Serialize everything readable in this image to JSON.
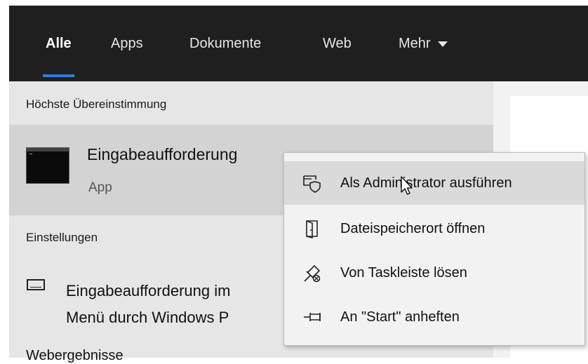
{
  "tabs": [
    {
      "label": "Alle"
    },
    {
      "label": "Apps"
    },
    {
      "label": "Dokumente"
    },
    {
      "label": "Web"
    },
    {
      "label": "Mehr"
    }
  ],
  "best_match": {
    "section_title": "Höchste Übereinstimmung",
    "title": "Eingabeaufforderung",
    "subtitle": "App",
    "icon": "command-prompt-icon"
  },
  "settings": {
    "section_title": "Einstellungen",
    "item_line1": "Eingabeaufforderung im",
    "item_line2": "Menü durch Windows P",
    "icon": "display-icon"
  },
  "web_section_peek": "Webergebnisse",
  "context_menu": {
    "items": [
      {
        "label": "Als Administrator ausführen",
        "icon": "run-as-admin-shield-icon"
      },
      {
        "label": "Dateispeicherort öffnen",
        "icon": "open-file-location-icon"
      },
      {
        "label": "Von Taskleiste lösen",
        "icon": "unpin-taskbar-icon"
      },
      {
        "label": "An \"Start\" anheften",
        "icon": "pin-start-icon"
      }
    ]
  },
  "colors": {
    "topbar_bg": "#1f1f1f",
    "accent": "#2b7fd9",
    "panel_bg": "#e6e6e6",
    "selected_row_bg": "#d3d3d3",
    "menu_bg": "#f2f2f2",
    "menu_hover_bg": "#dadada"
  }
}
